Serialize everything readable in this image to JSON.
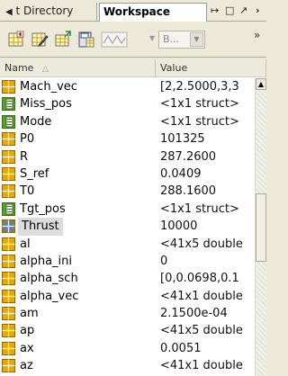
{
  "tabs": {
    "directory": {
      "arrow": "◀",
      "label": "t Directory"
    },
    "workspace": {
      "label": "Workspace"
    },
    "controls": {
      "undock": "↦",
      "maximize": "□",
      "pin": "↗",
      "close": "›"
    }
  },
  "toolbar": {
    "icons": [
      "new-variable-icon",
      "open-selection-icon",
      "import-data-icon",
      "save-icon",
      "plot-icon"
    ],
    "stack_label": "B...",
    "more": "»"
  },
  "columns": {
    "name": "Name",
    "sort_indicator": "△",
    "value": "Value"
  },
  "colors": {
    "matrix_icon": "#e8a800",
    "struct_icon": "#5aa02c",
    "selected_icon": "#6a7fa0",
    "selection": "#dcdcdc"
  },
  "variables": [
    {
      "name": "Mach_vec",
      "value": "[2,2.5000,3,3",
      "kind": "matrix"
    },
    {
      "name": "Miss_pos",
      "value": "<1x1 struct>",
      "kind": "struct"
    },
    {
      "name": "Mode",
      "value": "<1x1 struct>",
      "kind": "struct"
    },
    {
      "name": "P0",
      "value": "101325",
      "kind": "matrix"
    },
    {
      "name": "R",
      "value": "287.2600",
      "kind": "matrix"
    },
    {
      "name": "S_ref",
      "value": "0.0409",
      "kind": "matrix"
    },
    {
      "name": "T0",
      "value": "288.1600",
      "kind": "matrix"
    },
    {
      "name": "Tgt_pos",
      "value": "<1x1 struct>",
      "kind": "struct"
    },
    {
      "name": "Thrust",
      "value": "10000",
      "kind": "matrix",
      "selected": true
    },
    {
      "name": "al",
      "value": "<41x5 double",
      "kind": "matrix"
    },
    {
      "name": "alpha_ini",
      "value": "0",
      "kind": "matrix"
    },
    {
      "name": "alpha_sch",
      "value": "[0,0.0698,0.1",
      "kind": "matrix"
    },
    {
      "name": "alpha_vec",
      "value": "<41x1 double",
      "kind": "matrix"
    },
    {
      "name": "am",
      "value": "2.1500e-04",
      "kind": "matrix"
    },
    {
      "name": "ap",
      "value": "<41x5 double",
      "kind": "matrix"
    },
    {
      "name": "ax",
      "value": "0.0051",
      "kind": "matrix"
    },
    {
      "name": "az",
      "value": "<41x1 double",
      "kind": "matrix"
    }
  ]
}
